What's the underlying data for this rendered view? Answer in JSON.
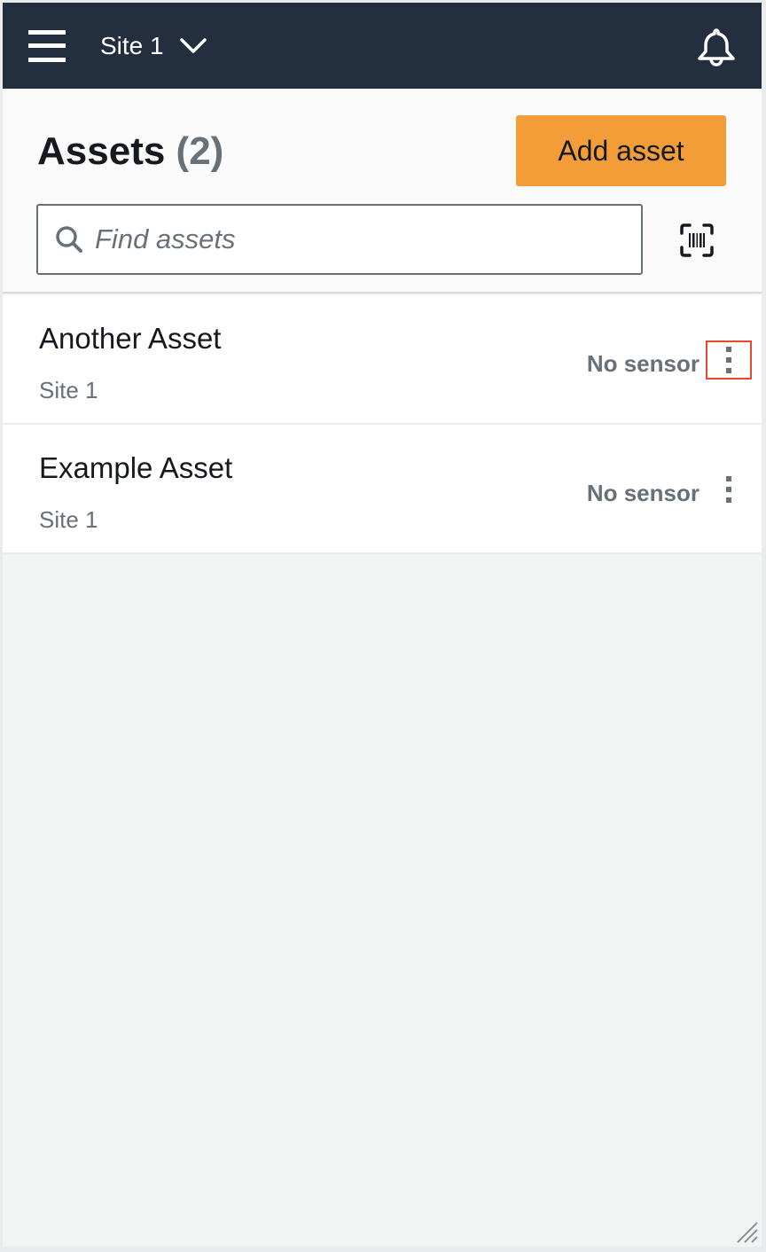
{
  "topbar": {
    "menu_icon": "hamburger-menu-icon",
    "site_selector": {
      "label": "Site 1",
      "icon": "chevron-down-icon"
    },
    "notifications_icon": "bell-icon"
  },
  "header": {
    "title": "Assets",
    "count": "(2)",
    "add_button_label": "Add asset",
    "add_button_color": "#f29d38",
    "search": {
      "value": "",
      "placeholder": "Find assets",
      "icon": "search-icon"
    },
    "scan_icon": "barcode-scan-icon"
  },
  "assets": [
    {
      "name": "Another Asset",
      "site": "Site 1",
      "sensor_status": "No sensor",
      "menu_icon": "more-vertical-icon",
      "highlighted": true
    },
    {
      "name": "Example Asset",
      "site": "Site 1",
      "sensor_status": "No sensor",
      "menu_icon": "more-vertical-icon",
      "highlighted": false
    }
  ],
  "colors": {
    "topbar_bg": "#232f3e",
    "accent": "#f29d38",
    "highlight_outline": "#e8472a",
    "secondary_text": "#687078"
  }
}
